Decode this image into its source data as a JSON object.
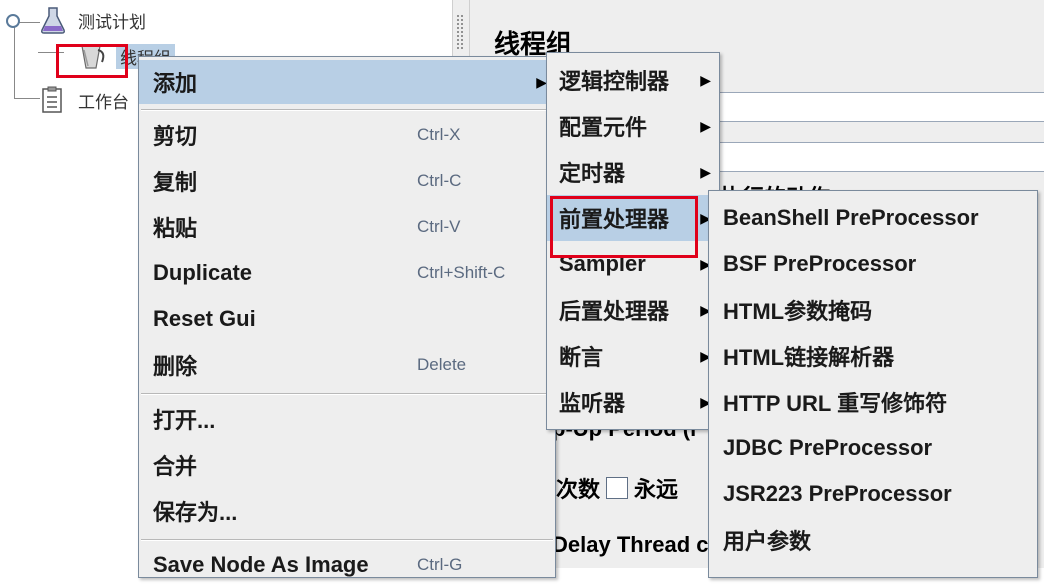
{
  "tree": {
    "items": [
      {
        "label": "测试计划"
      },
      {
        "label": "线程组"
      },
      {
        "label": "工作台"
      }
    ]
  },
  "right_panel": {
    "title": "线程组",
    "partial_labels": [
      "执行的动作",
      "p-Up Period (i",
      "次数",
      "永远",
      "Delay Thread c"
    ]
  },
  "context_menu": {
    "items": [
      {
        "label": "添加",
        "shortcut": "",
        "submenu": true
      },
      {
        "label": "剪切",
        "shortcut": "Ctrl-X"
      },
      {
        "label": "复制",
        "shortcut": "Ctrl-C"
      },
      {
        "label": "粘贴",
        "shortcut": "Ctrl-V"
      },
      {
        "label": "Duplicate",
        "shortcut": "Ctrl+Shift-C"
      },
      {
        "label": "Reset Gui",
        "shortcut": ""
      },
      {
        "label": "删除",
        "shortcut": "Delete"
      },
      {
        "label": "打开...",
        "shortcut": ""
      },
      {
        "label": "合并",
        "shortcut": ""
      },
      {
        "label": "保存为...",
        "shortcut": ""
      },
      {
        "label": "Save Node As Image",
        "shortcut": "Ctrl-G"
      }
    ]
  },
  "add_submenu": {
    "items": [
      {
        "label": "逻辑控制器"
      },
      {
        "label": "配置元件"
      },
      {
        "label": "定时器"
      },
      {
        "label": "前置处理器"
      },
      {
        "label": "Sampler"
      },
      {
        "label": "后置处理器"
      },
      {
        "label": "断言"
      },
      {
        "label": "监听器"
      }
    ]
  },
  "preprocessor_submenu": {
    "items": [
      {
        "label": "BeanShell PreProcessor"
      },
      {
        "label": "BSF PreProcessor"
      },
      {
        "label": "HTML参数掩码"
      },
      {
        "label": "HTML链接解析器"
      },
      {
        "label": "HTTP URL 重写修饰符"
      },
      {
        "label": "JDBC PreProcessor"
      },
      {
        "label": "JSR223 PreProcessor"
      },
      {
        "label": "用户参数"
      }
    ]
  },
  "colors": {
    "selection": "#b8cfe5",
    "highlight_box": "#e0001a",
    "menu_bg": "#eeeeee",
    "shortcut_text": "#5b6a80"
  },
  "icons": [
    "tree-handle-icon",
    "flask-icon",
    "thread-group-icon",
    "workbench-icon",
    "submenu-arrow-icon",
    "checkbox"
  ]
}
